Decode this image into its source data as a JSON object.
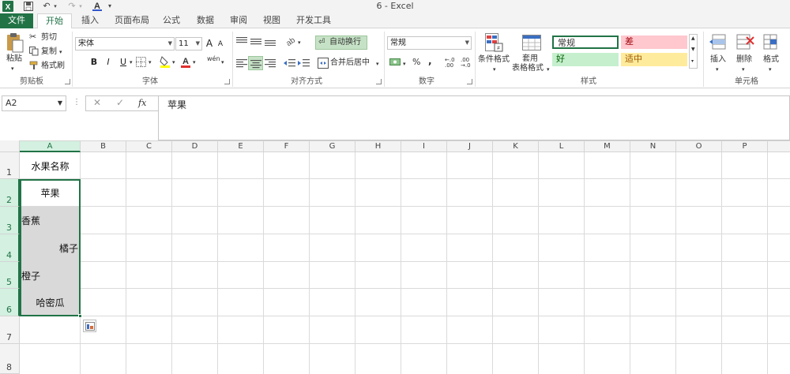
{
  "app": {
    "window_title": "6 - Excel",
    "app_icon": "excel-icon"
  },
  "tabs": [
    {
      "label": "文件"
    },
    {
      "label": "开始"
    },
    {
      "label": "插入"
    },
    {
      "label": "页面布局"
    },
    {
      "label": "公式"
    },
    {
      "label": "数据"
    },
    {
      "label": "审阅"
    },
    {
      "label": "视图"
    },
    {
      "label": "开发工具"
    }
  ],
  "ribbon": {
    "clipboard": {
      "label": "剪贴板",
      "paste": "粘贴",
      "cut": "剪切",
      "copy": "复制",
      "format_painter": "格式刷"
    },
    "font": {
      "label": "字体",
      "font_name": "宋体",
      "font_size": "11",
      "bold": "B",
      "italic": "I",
      "underline": "U",
      "grow": "A",
      "shrink": "A",
      "wen": "wén"
    },
    "alignment": {
      "label": "对齐方式",
      "wrap_text": "自动换行",
      "merge_center": "合并后居中"
    },
    "number": {
      "label": "数字",
      "format": "常规",
      "percent": "%",
      "comma": ",",
      "inc_decimal": "←.0 .00",
      "dec_decimal": ".00 →.0"
    },
    "styles": {
      "label": "样式",
      "conditional": "条件格式",
      "as_table_1": "套用",
      "as_table_2": "表格格式",
      "normal": "常规",
      "bad": "差",
      "good": "好",
      "neutral": "适中"
    },
    "cells": {
      "label": "单元格",
      "insert": "插入",
      "delete": "删除",
      "format": "格式"
    }
  },
  "formula_bar": {
    "name_box": "A2",
    "fx": "fx",
    "content": "苹果"
  },
  "columns": [
    "A",
    "B",
    "C",
    "D",
    "E",
    "F",
    "G",
    "H",
    "I",
    "J",
    "K",
    "L",
    "M",
    "N",
    "O",
    "P"
  ],
  "rows": [
    "1",
    "2",
    "3",
    "4",
    "5",
    "6",
    "7",
    "8"
  ],
  "cells": {
    "A1": "水果名称",
    "A2": "苹果",
    "A3": "香蕉",
    "A4": "橘子",
    "A5": "橙子",
    "A6": "哈密瓜"
  },
  "colors": {
    "excel_green": "#217346",
    "bad_fill": "#ffc7ce",
    "bad_text": "#9c0006",
    "good_fill": "#c6efce",
    "good_text": "#006100",
    "neutral_fill": "#ffeb9c",
    "neutral_text": "#9c5700"
  }
}
